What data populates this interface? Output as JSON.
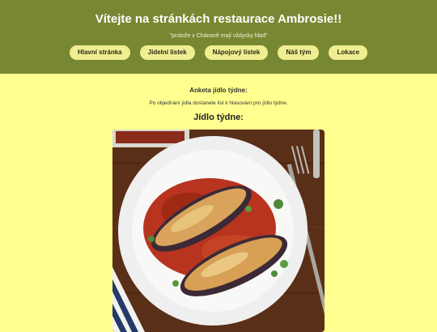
{
  "header": {
    "title": "Vítejte na stránkách restaurace Ambrosie!!",
    "tagline": "\"protože v Chánově mají vždycky hlad\""
  },
  "nav": {
    "items": [
      "Hlavní stránka",
      "Jídelní lístek",
      "Nápojový lístek",
      "Náš tým",
      "Lokace"
    ]
  },
  "main": {
    "poll_title": "Anketa jídlo týdne:",
    "poll_text": "Po objednání jídla dostanete list k hlasování pro jídlo týdne.",
    "dish_heading": "Jídlo týdne:"
  },
  "colors": {
    "header_bg": "#788832",
    "page_bg": "#ffff8f",
    "nav_button_bg": "#efef92"
  }
}
